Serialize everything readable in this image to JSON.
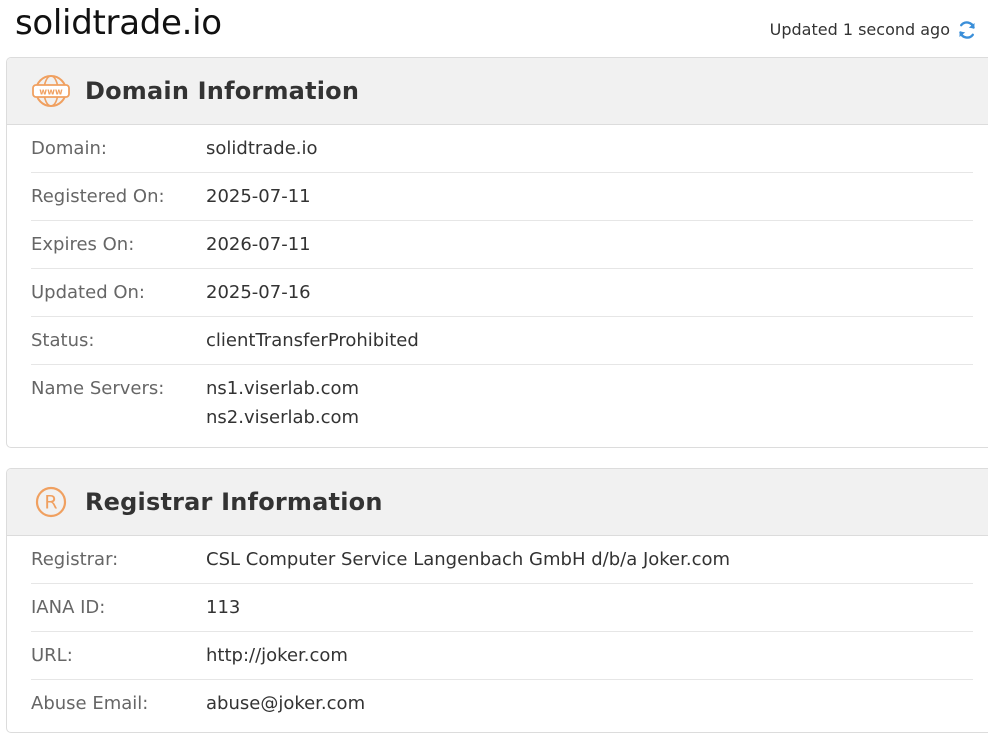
{
  "header": {
    "title": "solidtrade.io",
    "updated_text": "Updated 1 second ago"
  },
  "domain_card": {
    "title": "Domain Information",
    "icon": "www-icon",
    "rows": [
      {
        "label": "Domain:",
        "value": "solidtrade.io"
      },
      {
        "label": "Registered On:",
        "value": "2025-07-11"
      },
      {
        "label": "Expires On:",
        "value": "2026-07-11"
      },
      {
        "label": "Updated On:",
        "value": "2025-07-16"
      },
      {
        "label": "Status:",
        "value": "clientTransferProhibited"
      },
      {
        "label": "Name Servers:",
        "values": [
          "ns1.viserlab.com",
          "ns2.viserlab.com"
        ]
      }
    ]
  },
  "registrar_card": {
    "title": "Registrar Information",
    "icon": "registered-icon",
    "rows": [
      {
        "label": "Registrar:",
        "value": "CSL Computer Service Langenbach GmbH d/b/a Joker.com"
      },
      {
        "label": "IANA ID:",
        "value": "113"
      },
      {
        "label": "URL:",
        "value": "http://joker.com"
      },
      {
        "label": "Abuse Email:",
        "value": "abuse@joker.com"
      }
    ]
  },
  "colors": {
    "accent_orange": "#f0a060",
    "refresh_blue": "#3b8fd9"
  }
}
